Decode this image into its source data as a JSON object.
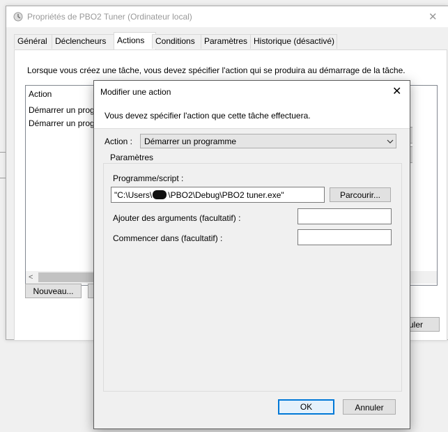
{
  "background_window": {
    "title": "Propriétés de PBO2 Tuner (Ordinateur local)",
    "close": "✕",
    "tabs": [
      {
        "label": "Général",
        "active": false
      },
      {
        "label": "Déclencheurs",
        "active": false
      },
      {
        "label": "Actions",
        "active": true
      },
      {
        "label": "Conditions",
        "active": false
      },
      {
        "label": "Paramètres",
        "active": false
      },
      {
        "label": "Historique (désactivé)",
        "active": false
      }
    ],
    "description": "Lorsque vous créez une tâche, vous devez spécifier l'action qui se produira au démarrage de la tâche.",
    "list": {
      "header": "Action",
      "rows": [
        "Démarrer un prog",
        "Démarrer un prog"
      ]
    },
    "new_button": "Nouveau...",
    "cancel_partial": "uler"
  },
  "dialog": {
    "title": "Modifier une action",
    "close": "✕",
    "description": "Vous devez spécifier l'action que cette tâche effectuera.",
    "action_label": "Action :",
    "action_value": "Démarrer un programme",
    "params_legend": "Paramètres",
    "program_label": "Programme/script :",
    "program_value_prefix": "\"C:\\Users\\",
    "program_value_suffix": "\\PBO2\\Debug\\PBO2 tuner.exe\"",
    "browse_button": "Parcourir...",
    "args_label": "Ajouter des arguments (facultatif) :",
    "args_value": "",
    "start_in_label": "Commencer dans (facultatif) :",
    "start_in_value": "",
    "ok_button": "OK",
    "cancel_button": "Annuler"
  },
  "colors": {
    "accent": "#0078d7",
    "background": "#f0f0f0"
  }
}
